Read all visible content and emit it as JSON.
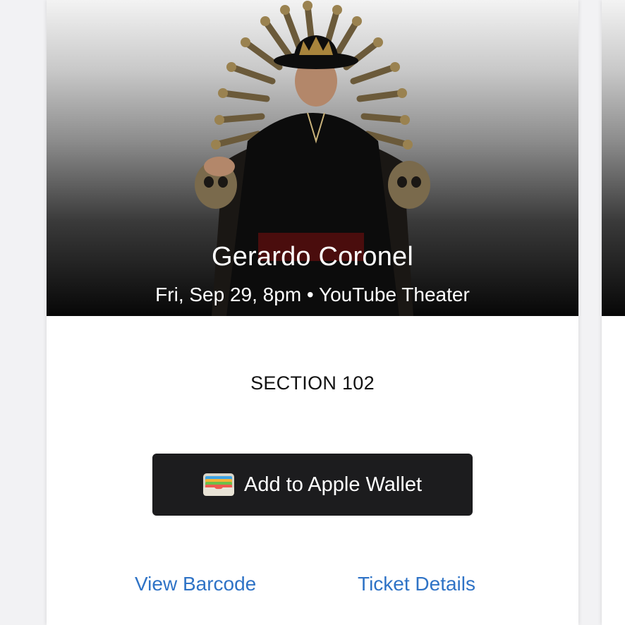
{
  "event": {
    "title": "Gerardo Coronel",
    "subtitle": "Fri, Sep 29, 8pm • YouTube Theater"
  },
  "ticket": {
    "section": "SECTION 102"
  },
  "actions": {
    "wallet_label": "Add to Apple Wallet",
    "view_barcode": "View Barcode",
    "ticket_details": "Ticket Details"
  },
  "icons": {
    "wallet": "apple-wallet-icon"
  },
  "colors": {
    "link": "#2f73c6",
    "wallet_button": "#1c1c1e"
  }
}
